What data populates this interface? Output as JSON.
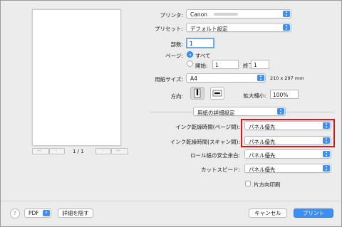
{
  "preview": {
    "page_counter": "1 / 1",
    "first_label": "««",
    "prev_label": "‹",
    "next_label": "›",
    "last_label": "»»"
  },
  "printer": {
    "label": "プリンタ:",
    "value": "Canon"
  },
  "preset": {
    "label": "プリセット:",
    "value": "デフォルト設定"
  },
  "copies": {
    "label": "部数:",
    "value": "1"
  },
  "pages": {
    "label": "ページ:",
    "all_label": "すべて",
    "from_label": "開始:",
    "from_value": "1",
    "to_label": "終了:",
    "to_value": "1"
  },
  "paper_size": {
    "label": "用紙サイズ:",
    "value": "A4",
    "dimensions": "210 x 297 mm"
  },
  "orientation": {
    "label": "方向:"
  },
  "scale": {
    "label": "拡大縮小:",
    "value": "100%"
  },
  "section": {
    "value": "用紙の詳細設定"
  },
  "settings": {
    "ink_page": {
      "label": "インク乾燥時間(ページ間):",
      "value": "パネル優先"
    },
    "ink_scan": {
      "label": "インク乾燥時間(スキャン間):",
      "value": "パネル優先"
    },
    "roll_margin": {
      "label": "ロール紙の安全余白:",
      "value": "パネル優先"
    },
    "cut_speed": {
      "label": "カットスピード:",
      "value": "パネル優先"
    },
    "one_way_label": "片方向印刷"
  },
  "footer": {
    "help_label": "?",
    "pdf_label": "PDF",
    "hide_details_label": "詳細を隠す",
    "cancel_label": "キャンセル",
    "print_label": "プリント"
  },
  "colors": {
    "accent": "#3d8ef5",
    "highlight": "#e2141b",
    "background": "#ececec"
  }
}
